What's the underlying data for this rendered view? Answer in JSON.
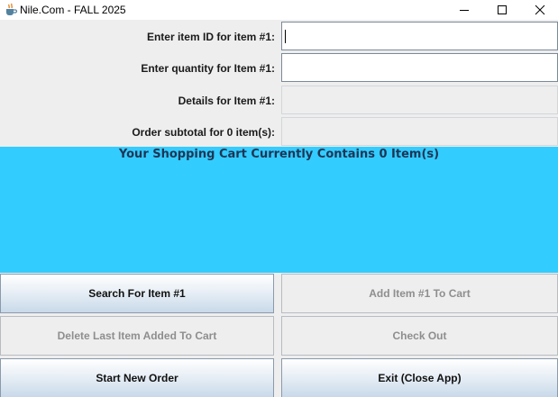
{
  "window": {
    "title": "Nile.Com - FALL 2025",
    "app_icon": "java-cup-icon",
    "controls": [
      "minimize-icon",
      "maximize-icon",
      "close-icon"
    ]
  },
  "form": {
    "item_id_label": "Enter item ID for item #1:",
    "item_id_value": "",
    "quantity_label": "Enter quantity for Item #1:",
    "quantity_value": "",
    "details_label": "Details for Item #1:",
    "details_value": "",
    "subtotal_label": "Order subtotal for 0 item(s):",
    "subtotal_value": ""
  },
  "cart": {
    "heading": "Your Shopping Cart Currently Contains 0 Item(s)",
    "background_color": "#33ccff"
  },
  "buttons": {
    "search": "Search For Item #1",
    "add": "Add Item #1 To Cart",
    "delete": "Delete Last Item Added To Cart",
    "checkout": "Check Out",
    "new_order": "Start New Order",
    "exit": "Exit (Close App)"
  }
}
